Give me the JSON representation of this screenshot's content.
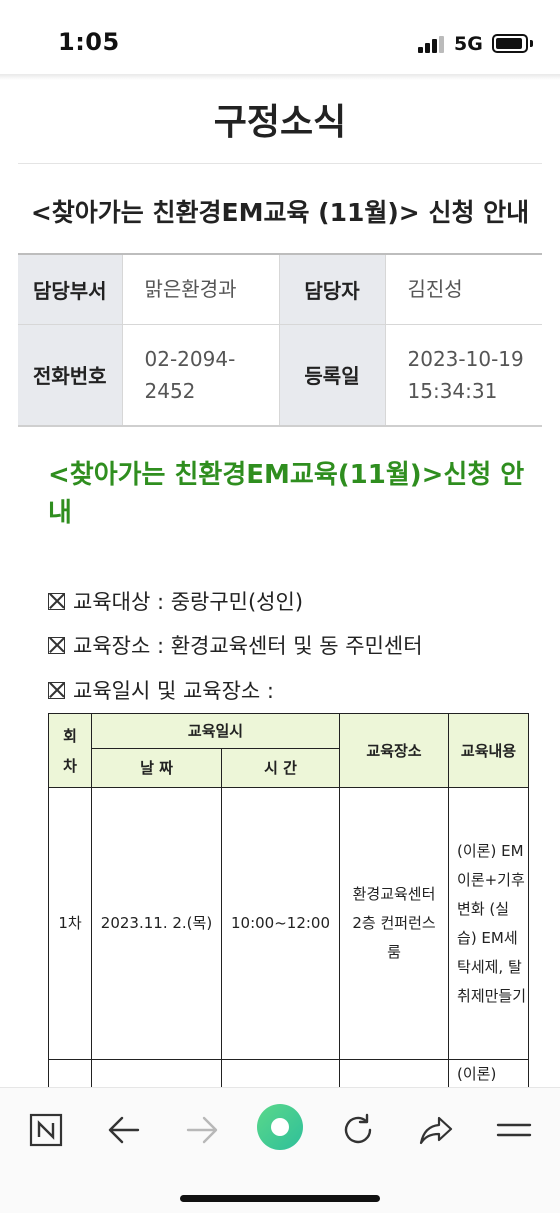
{
  "status_bar": {
    "time": "1:05",
    "network": "5G"
  },
  "page": {
    "title": "구정소식",
    "notice_title": "<찾아가는 친환경EM교육 (11월)> 신청 안내"
  },
  "info": {
    "department_label": "담당부서",
    "department_value": "맑은환경과",
    "manager_label": "담당자",
    "manager_value": "김진성",
    "phone_label": "전화번호",
    "phone_value": "02-2094-2452",
    "date_label": "등록일",
    "date_value": "2023-10-19 15:34:31"
  },
  "content": {
    "heading": "<찾아가는 친환경EM교육(11월)>신청 안내",
    "bullets": [
      "교육대상 : 중랑구민(성인)",
      "교육장소 : 환경교육센터 및 동 주민센터",
      "교육일시 및 교육장소 :"
    ]
  },
  "schedule": {
    "headers": {
      "round": "회차",
      "datetime": "교육일시",
      "date": "날 짜",
      "time": "시 간",
      "place": "교육장소",
      "content": "교육내용"
    },
    "rows": [
      {
        "round": "1차",
        "date": "2023.11. 2.(목)",
        "time": "10:00~12:00",
        "place": "환경교육센터 2층 컨퍼런스룸",
        "content": "(이론) EM이론+기후변화 (실습) EM세탁세제, 탈취제만들기"
      },
      {
        "round": "",
        "date": "",
        "time": "",
        "place": "",
        "content": "(이론)"
      }
    ]
  },
  "toolbar": {
    "buttons": [
      "naver-home-icon",
      "back-arrow-icon",
      "forward-arrow-icon",
      "green-dot-icon",
      "refresh-icon",
      "share-icon",
      "menu-icon"
    ]
  },
  "colors": {
    "accent_green": "#2f8e1f",
    "table_header_bg": "#edf6d8",
    "label_bg": "#e8eaee",
    "green_button": "#3dcb7f"
  }
}
